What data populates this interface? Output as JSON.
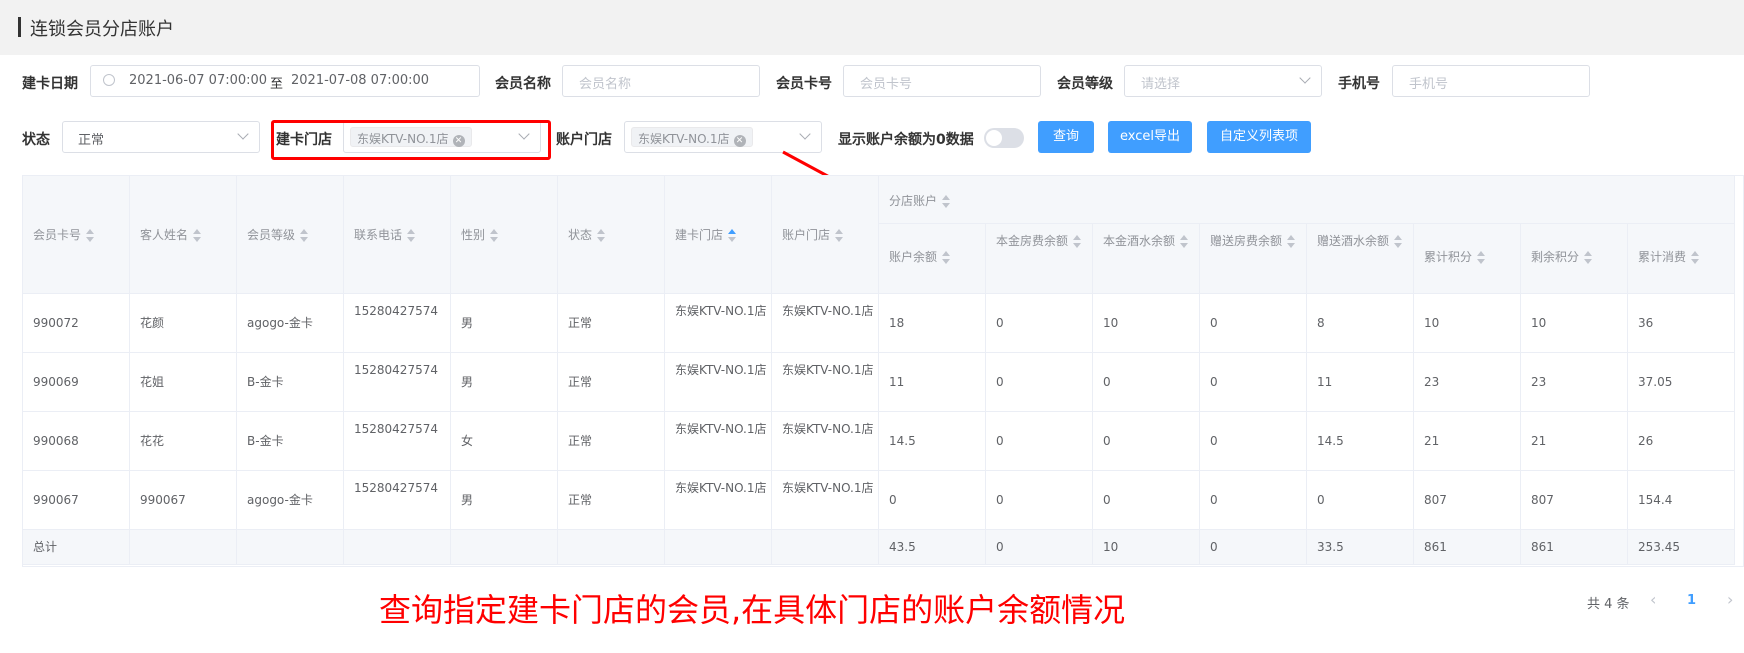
{
  "page_title": "连锁会员分店账户",
  "filters": {
    "card_date_label": "建卡日期",
    "date_start": "2021-06-07 07:00:00",
    "date_sep": "至",
    "date_end": "2021-07-08 07:00:00",
    "member_name_label": "会员名称",
    "member_name_placeholder": "会员名称",
    "card_no_label": "会员卡号",
    "card_no_placeholder": "会员卡号",
    "level_label": "会员等级",
    "level_placeholder": "请选择",
    "phone_label": "手机号",
    "phone_placeholder": "手机号",
    "status_label": "状态",
    "status_value": "正常",
    "card_store_label": "建卡门店",
    "card_store_tag": "东娱KTV-NO.1店",
    "account_store_label": "账户门店",
    "account_store_tag": "东娱KTV-NO.1店",
    "zero_balance_label": "显示账户余额为0数据",
    "query_btn": "查询",
    "export_btn": "excel导出",
    "custom_btn": "自定义列表项"
  },
  "table": {
    "group_header": "分店账户",
    "left_headers": [
      "会员卡号",
      "客人姓名",
      "会员等级",
      "联系电话",
      "性别",
      "状态",
      "建卡门店",
      "账户门店"
    ],
    "right_headers": [
      "账户余额",
      "本金房费余额",
      "本金酒水余额",
      "赠送房费余额",
      "赠送酒水余额",
      "累计积分",
      "剩余积分",
      "累计消费"
    ],
    "rows": [
      [
        "990072",
        "花颜",
        "agogo-金卡",
        "15280427574",
        "男",
        "正常",
        "东娱KTV-NO.1店",
        "东娱KTV-NO.1店",
        "18",
        "0",
        "10",
        "0",
        "8",
        "10",
        "10",
        "36"
      ],
      [
        "990069",
        "花姐",
        "B-金卡",
        "15280427574",
        "男",
        "正常",
        "东娱KTV-NO.1店",
        "东娱KTV-NO.1店",
        "11",
        "0",
        "0",
        "0",
        "11",
        "23",
        "23",
        "37.05"
      ],
      [
        "990068",
        "花花",
        "B-金卡",
        "15280427574",
        "女",
        "正常",
        "东娱KTV-NO.1店",
        "东娱KTV-NO.1店",
        "14.5",
        "0",
        "0",
        "0",
        "14.5",
        "21",
        "21",
        "26"
      ],
      [
        "990067",
        "990067",
        "agogo-金卡",
        "15280427574",
        "男",
        "正常",
        "东娱KTV-NO.1店",
        "东娱KTV-NO.1店",
        "0",
        "0",
        "0",
        "0",
        "0",
        "807",
        "807",
        "154.4"
      ]
    ],
    "summary": [
      "总计",
      "",
      "",
      "",
      "",
      "",
      "",
      "",
      "43.5",
      "0",
      "10",
      "0",
      "33.5",
      "861",
      "861",
      "253.45"
    ]
  },
  "annotation": "查询指定建卡门店的会员,在具体门店的账户余额情况",
  "pager": {
    "total": "共 4 条",
    "current": "1",
    "prev": "‹",
    "next": "›"
  }
}
